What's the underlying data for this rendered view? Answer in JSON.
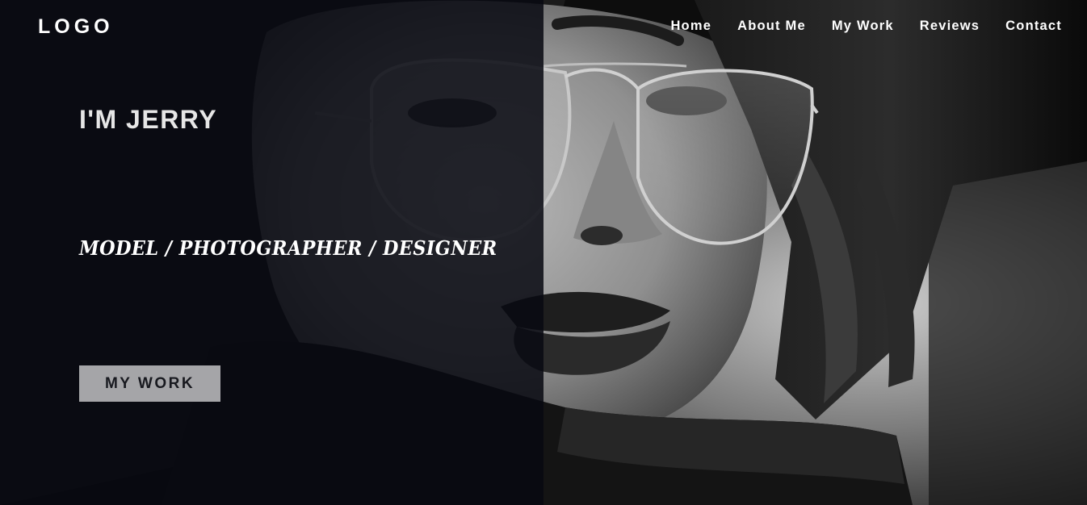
{
  "header": {
    "logo": "LOGO",
    "nav": [
      "Home",
      "About Me",
      "My Work",
      "Reviews",
      "Contact"
    ]
  },
  "hero": {
    "headline": "I'M JERRY",
    "roles": "MODEL / PHOTOGRAPHER / DESIGNER",
    "cta_label": "MY WORK"
  },
  "colors": {
    "overlay": "#080912",
    "cta_bg": "#a5a5a8",
    "cta_text": "#18191f",
    "text": "#ffffff"
  }
}
